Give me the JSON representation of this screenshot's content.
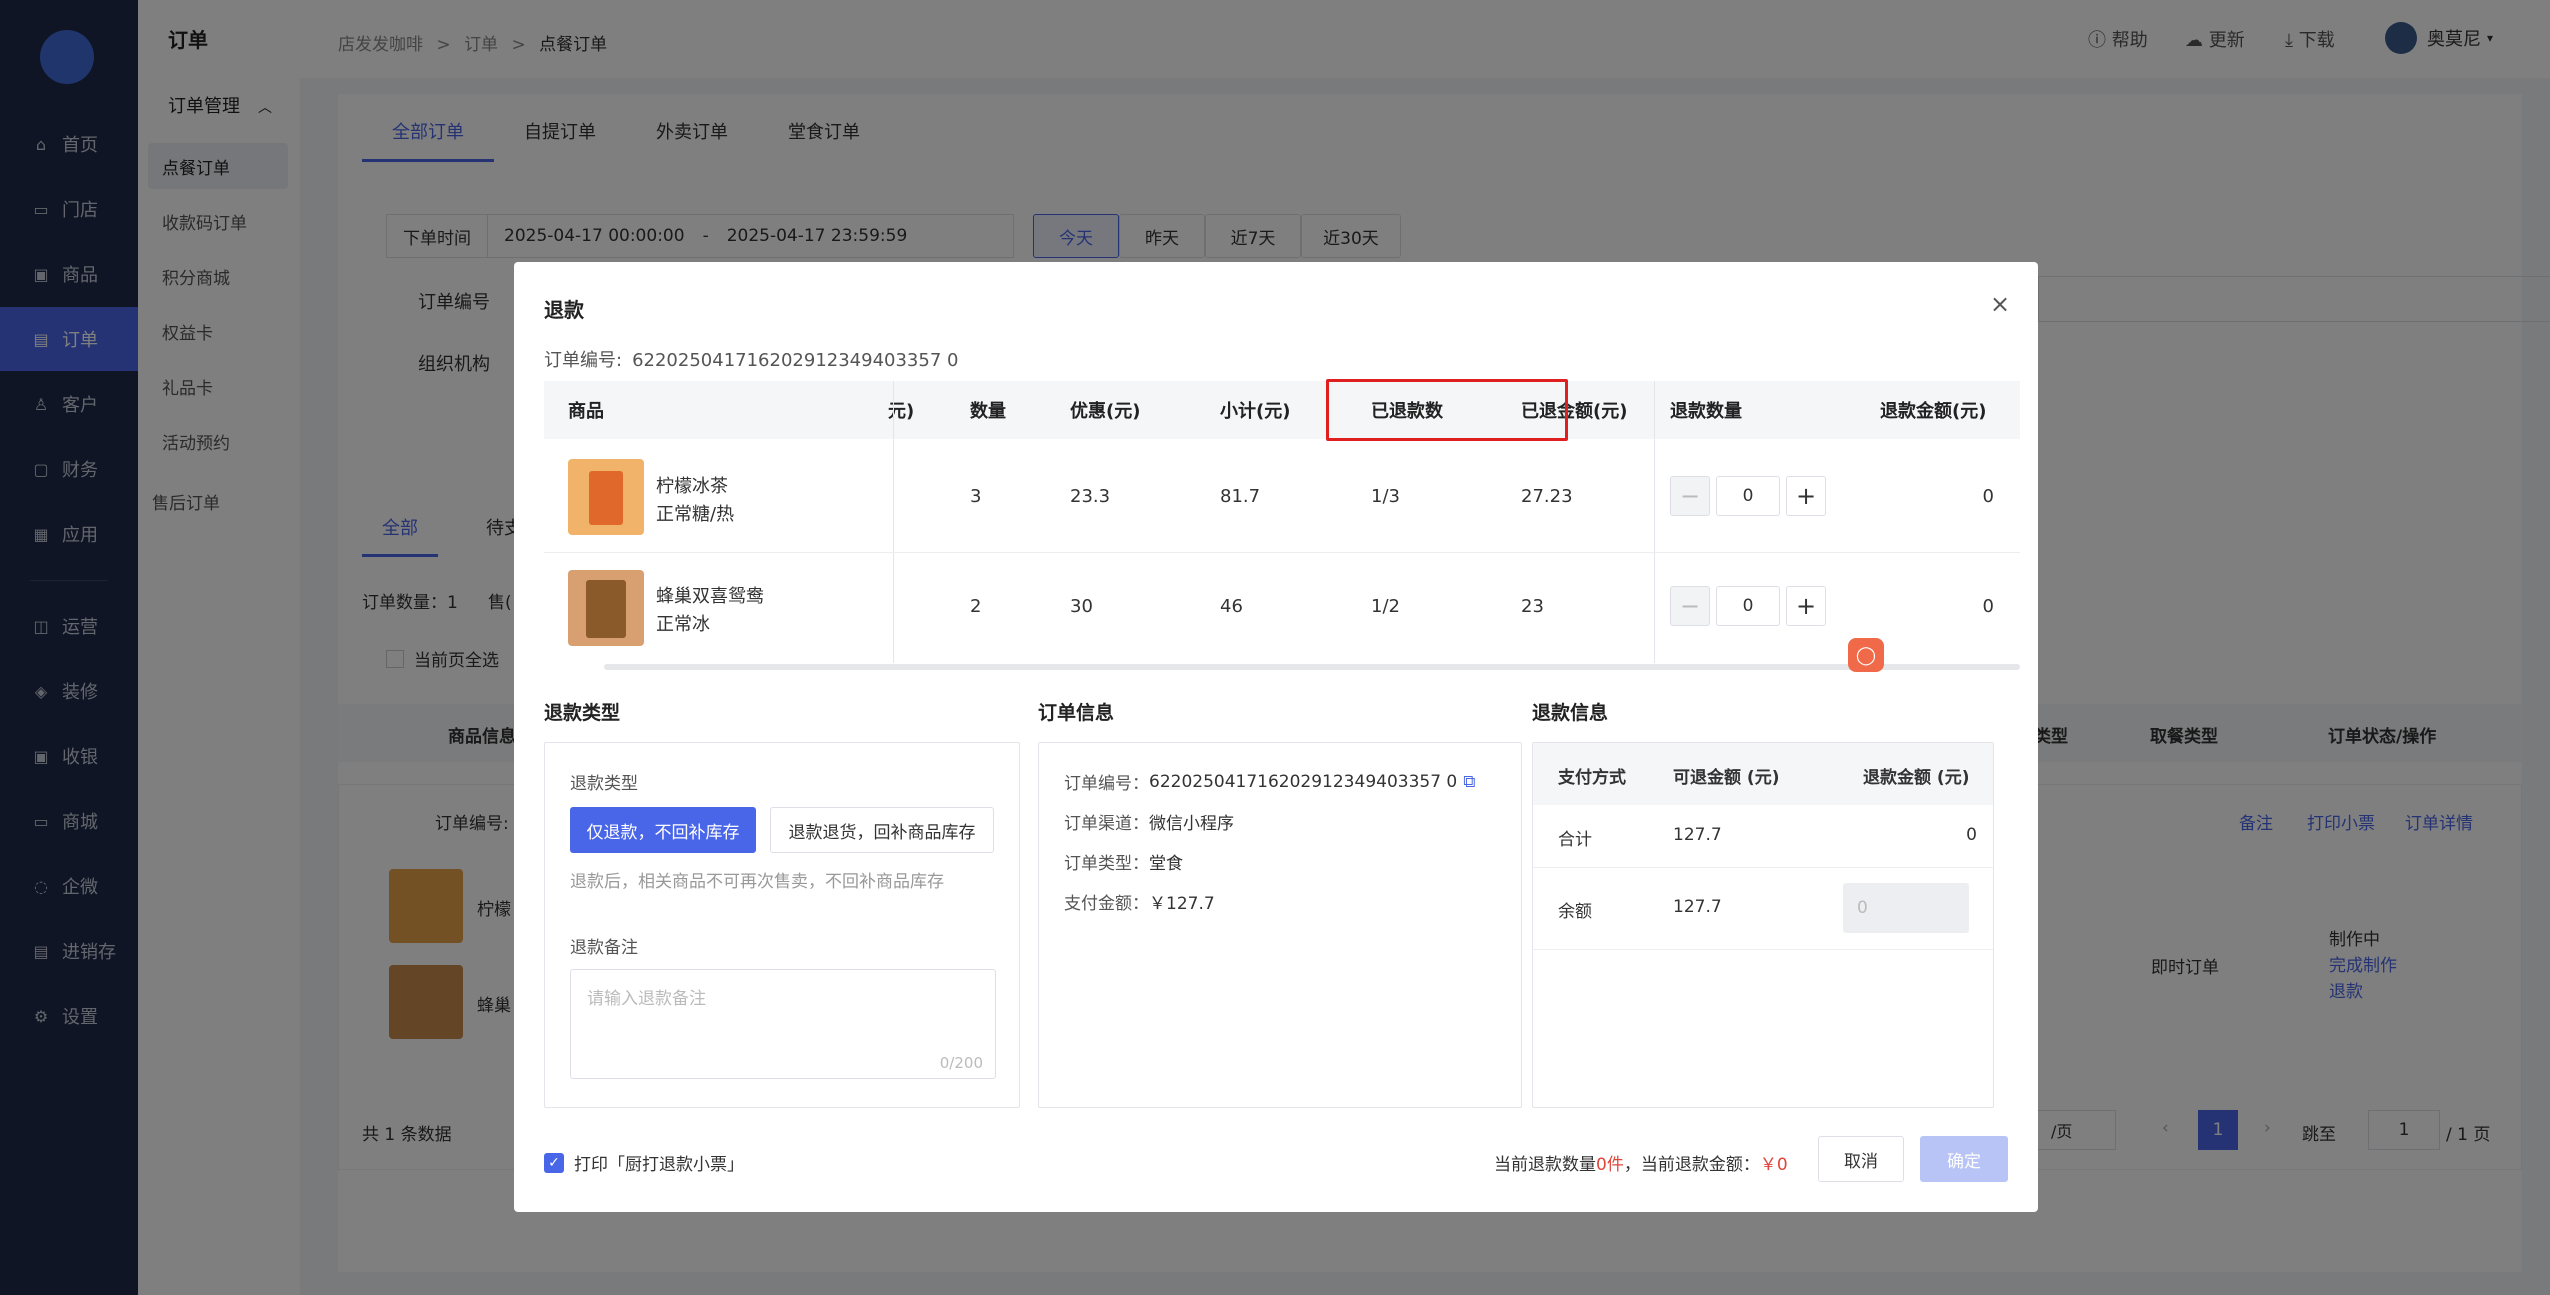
{
  "sidebar": {
    "items": [
      {
        "label": "首页",
        "icon": "home-icon",
        "glyph": "⌂"
      },
      {
        "label": "门店",
        "icon": "store-icon",
        "glyph": "▭"
      },
      {
        "label": "商品",
        "icon": "goods-icon",
        "glyph": "▣"
      },
      {
        "label": "订单",
        "icon": "order-icon",
        "glyph": "▤"
      },
      {
        "label": "客户",
        "icon": "customer-icon",
        "glyph": "♙"
      },
      {
        "label": "财务",
        "icon": "finance-icon",
        "glyph": "▢"
      },
      {
        "label": "应用",
        "icon": "apps-icon",
        "glyph": "▦"
      },
      {
        "label": "运营",
        "icon": "operation-icon",
        "glyph": "◫"
      },
      {
        "label": "装修",
        "icon": "decoration-icon",
        "glyph": "◈"
      },
      {
        "label": "收银",
        "icon": "cashier-icon",
        "glyph": "▣"
      },
      {
        "label": "商城",
        "icon": "mall-icon",
        "glyph": "▭"
      },
      {
        "label": "企微",
        "icon": "wecom-icon",
        "glyph": "◌"
      },
      {
        "label": "进销存",
        "icon": "inventory-icon",
        "glyph": "▤"
      },
      {
        "label": "设置",
        "icon": "settings-icon",
        "glyph": "⚙"
      }
    ],
    "active": "订单"
  },
  "subnav": {
    "title": "订单",
    "group": "订单管理",
    "items": [
      "点餐订单",
      "收款码订单",
      "积分商城",
      "权益卡",
      "礼品卡",
      "活动预约",
      "售后订单"
    ]
  },
  "topbar": {
    "breadcrumb": [
      "店发发咖啡",
      "订单",
      "点餐订单"
    ],
    "help": "帮助",
    "update": "更新",
    "download": "下载",
    "user": "奥莫尼"
  },
  "background": {
    "tabs": [
      "全部订单",
      "自提订单",
      "外卖订单",
      "堂食订单"
    ],
    "time_type": "下单时间",
    "date_start": "2025-04-17 00:00:00",
    "date_sep": "-",
    "date_end": "2025-04-17 23:59:59",
    "quick_dates": [
      "今天",
      "昨天",
      "近7天",
      "近30天"
    ],
    "order_no_label": "订单编号",
    "org_label": "组织机构",
    "status_tabs": [
      "全部",
      "待支"
    ],
    "order_count": "订单数量：1",
    "sold_prefix": "售(",
    "select_all": "当前页全选",
    "headers": [
      "商品信息",
      "类型",
      "取餐类型",
      "订单状态/操作"
    ],
    "row_order_no": "订单编号:",
    "row_links": [
      "备注",
      "打印小票",
      "订单详情"
    ],
    "items": [
      "柠檬",
      "蜂巢"
    ],
    "pickup": "即时订单",
    "status": "制作中",
    "actions": [
      "完成制作",
      "退款"
    ],
    "total": "共 1 条数据",
    "per_page": "/页",
    "page": "1",
    "jump_label": "跳至",
    "jump_value": "1",
    "page_total": "/ 1 页"
  },
  "modal": {
    "title": "退款",
    "order_no_label": "订单编号:",
    "order_no": "622025041716202912349403357 0",
    "columns": {
      "product": "商品",
      "price_tail": "元)",
      "qty": "数量",
      "discount": "优惠(元)",
      "subtotal": "小计(元)",
      "refunded_count": "已退款数",
      "refunded_amount": "已退金额(元)",
      "refund_qty": "退款数量",
      "refund_amount": "退款金额(元)"
    },
    "rows": [
      {
        "name": "柠檬冰茶",
        "spec": "正常糖/热",
        "qty": "3",
        "discount": "23.3",
        "subtotal": "81.7",
        "refunded_count": "1/3",
        "refunded_amount": "27.23",
        "refund_qty": "0",
        "refund_amount": "0"
      },
      {
        "name": "蜂巢双喜鸳鸯",
        "spec": "正常冰",
        "qty": "2",
        "discount": "30",
        "subtotal": "46",
        "refunded_count": "1/2",
        "refunded_amount": "23",
        "refund_qty": "0",
        "refund_amount": "0"
      }
    ],
    "refund_type": {
      "section": "退款类型",
      "label": "退款类型",
      "opt1": "仅退款，不回补库存",
      "opt2": "退款退货，回补商品库存",
      "hint": "退款后，相关商品不可再次售卖，不回补商品库存",
      "remark_label": "退款备注",
      "remark_placeholder": "请输入退款备注",
      "remark_count": "0/200"
    },
    "order_info": {
      "section": "订单信息",
      "no_label": "订单编号：",
      "no": "622025041716202912349403357 0",
      "channel_label": "订单渠道：",
      "channel": "微信小程序",
      "type_label": "订单类型：",
      "type": "堂食",
      "pay_label": "支付金额：",
      "pay": "￥127.7"
    },
    "refund_info": {
      "section": "退款信息",
      "h1": "支付方式",
      "h2": "可退金额 (元)",
      "h3": "退款金额 (元)",
      "r1": [
        "合计",
        "127.7",
        "0"
      ],
      "r2": [
        "余额",
        "127.7"
      ],
      "r2_placeholder": "0"
    },
    "footer": {
      "print_label": "打印「厨打退款小票」",
      "summary_prefix": "当前退款数量",
      "summary_count": "0件",
      "summary_mid": "，当前退款金额：",
      "summary_amount": "￥0",
      "cancel": "取消",
      "confirm": "确定"
    }
  },
  "colors": {
    "accent": "#4a66e8",
    "sidebar": "#1e2a4b",
    "highlight_box": "#e02020",
    "danger": "#e0453a"
  }
}
